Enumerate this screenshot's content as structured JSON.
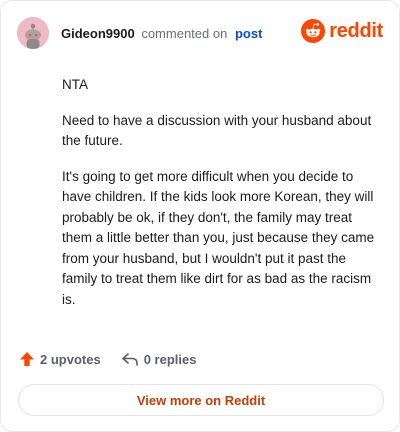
{
  "header": {
    "username": "Gideon9900",
    "action_text": "commented on",
    "post_link": "post",
    "brand": "reddit"
  },
  "comment": {
    "paragraphs": [
      "NTA",
      "Need to have a discussion with your husband about the future.",
      "It's going to get more difficult when you decide to have children. If the kids look more Korean, they will probably be ok, if they don't, the family may treat them a little better than you, just because they came from your husband, but I wouldn't put it past the family to treat them like dirt for as bad as the racism is."
    ]
  },
  "footer": {
    "upvotes": "2 upvotes",
    "replies": "0 replies",
    "view_more": "View more on Reddit"
  },
  "colors": {
    "brand": "#ff4500",
    "link": "#0a4dc4",
    "view_more": "#c53d00"
  }
}
